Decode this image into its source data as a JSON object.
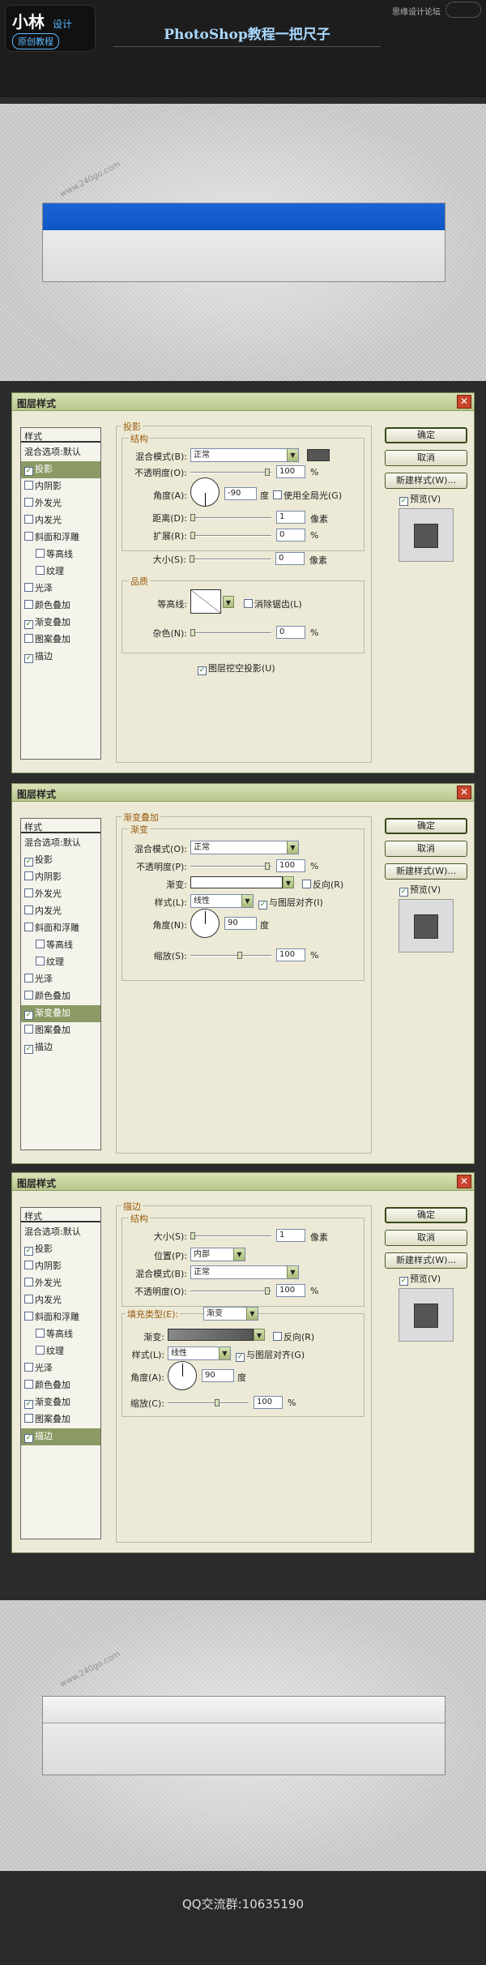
{
  "header": {
    "logo_main": "小林",
    "logo_sub1": "设计",
    "logo_sub2": "原创教程",
    "title": "PhotoShop教程一把尺子",
    "top_watermark": "思缘设计论坛"
  },
  "watermark": "www.240go.com",
  "dialog_common": {
    "title": "图层样式",
    "close": "✕",
    "side_head": "样式",
    "ok": "确定",
    "cancel": "取消",
    "new_style": "新建样式(W)...",
    "preview": "预览(V)"
  },
  "sidebar_items": [
    "混合选项:默认",
    "投影",
    "内阴影",
    "外发光",
    "内发光",
    "斜面和浮雕",
    "等高线",
    "纹理",
    "光泽",
    "颜色叠加",
    "渐变叠加",
    "图案叠加",
    "描边"
  ],
  "dialog1": {
    "section": "投影",
    "group1": "结构",
    "blend_mode_label": "混合模式(B):",
    "blend_mode": "正常",
    "opacity_label": "不透明度(O):",
    "opacity": "100",
    "pct": "%",
    "angle_label": "角度(A):",
    "angle": "-90",
    "deg": "度",
    "global_light": "使用全局光(G)",
    "distance_label": "距离(D):",
    "distance": "1",
    "spread_label": "扩展(R):",
    "spread": "0",
    "size_label": "大小(S):",
    "size": "0",
    "px": "像素",
    "group2": "品质",
    "contour_label": "等高线:",
    "antialias": "消除锯齿(L)",
    "noise_label": "杂色(N):",
    "noise": "0",
    "knockout": "图层挖空投影(U)"
  },
  "dialog2": {
    "section": "渐变叠加",
    "group1": "渐变",
    "blend_mode_label": "混合模式(O):",
    "blend_mode": "正常",
    "opacity_label": "不透明度(P):",
    "opacity": "100",
    "pct": "%",
    "gradient_label": "渐变:",
    "reverse": "反向(R)",
    "style_label": "样式(L):",
    "style": "线性",
    "align": "与图层对齐(I)",
    "angle_label": "角度(N):",
    "angle": "90",
    "deg": "度",
    "scale_label": "缩放(S):",
    "scale": "100"
  },
  "dialog3": {
    "section": "描边",
    "group1": "结构",
    "size_label": "大小(S):",
    "size": "1",
    "px": "像素",
    "position_label": "位置(P):",
    "position": "内部",
    "blend_mode_label": "混合模式(B):",
    "blend_mode": "正常",
    "opacity_label": "不透明度(O):",
    "opacity": "100",
    "pct": "%",
    "fill_type_label": "填充类型(E):",
    "fill_type": "渐变",
    "gradient_label": "渐变:",
    "reverse": "反向(R)",
    "style_label": "样式(L):",
    "style": "线性",
    "align": "与图层对齐(G)",
    "angle_label": "角度(A):",
    "angle": "90",
    "deg": "度",
    "scale_label": "缩放(C):",
    "scale": "100"
  },
  "footer": {
    "text": "QQ交流群:10635190"
  },
  "colors": {
    "ruler_blue": "#1160d0",
    "dialog_bg": "#ecead6",
    "selected_item": "#8b9a64"
  }
}
